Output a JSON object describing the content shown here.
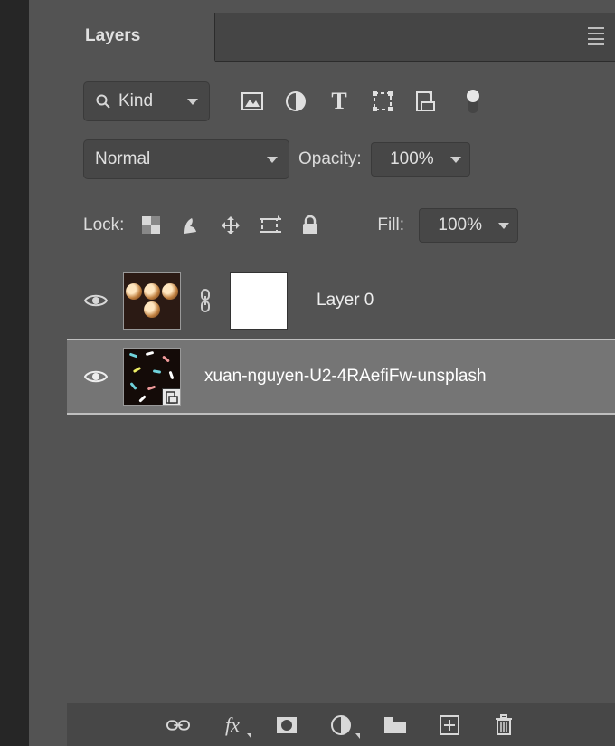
{
  "panel": {
    "title": "Layers"
  },
  "filter": {
    "kind_label": "Kind",
    "icons": [
      "image-filter",
      "adjustment-filter",
      "type-filter",
      "shape-filter",
      "smartobject-filter"
    ]
  },
  "blend": {
    "mode": "Normal",
    "opacity_label": "Opacity:",
    "opacity_value": "100%",
    "lock_label": "Lock:",
    "fill_label": "Fill:",
    "fill_value": "100%"
  },
  "layers": [
    {
      "name": "Layer 0",
      "visible": true,
      "has_mask": true,
      "linked": true,
      "selected": false,
      "type": "raster"
    },
    {
      "name": "xuan-nguyen-U2-4RAefiFw-unsplash",
      "visible": true,
      "has_mask": false,
      "linked": false,
      "selected": true,
      "type": "smartobject"
    }
  ],
  "bottom_icons": [
    "link",
    "fx",
    "mask",
    "adjustment",
    "group",
    "new-layer",
    "trash"
  ]
}
